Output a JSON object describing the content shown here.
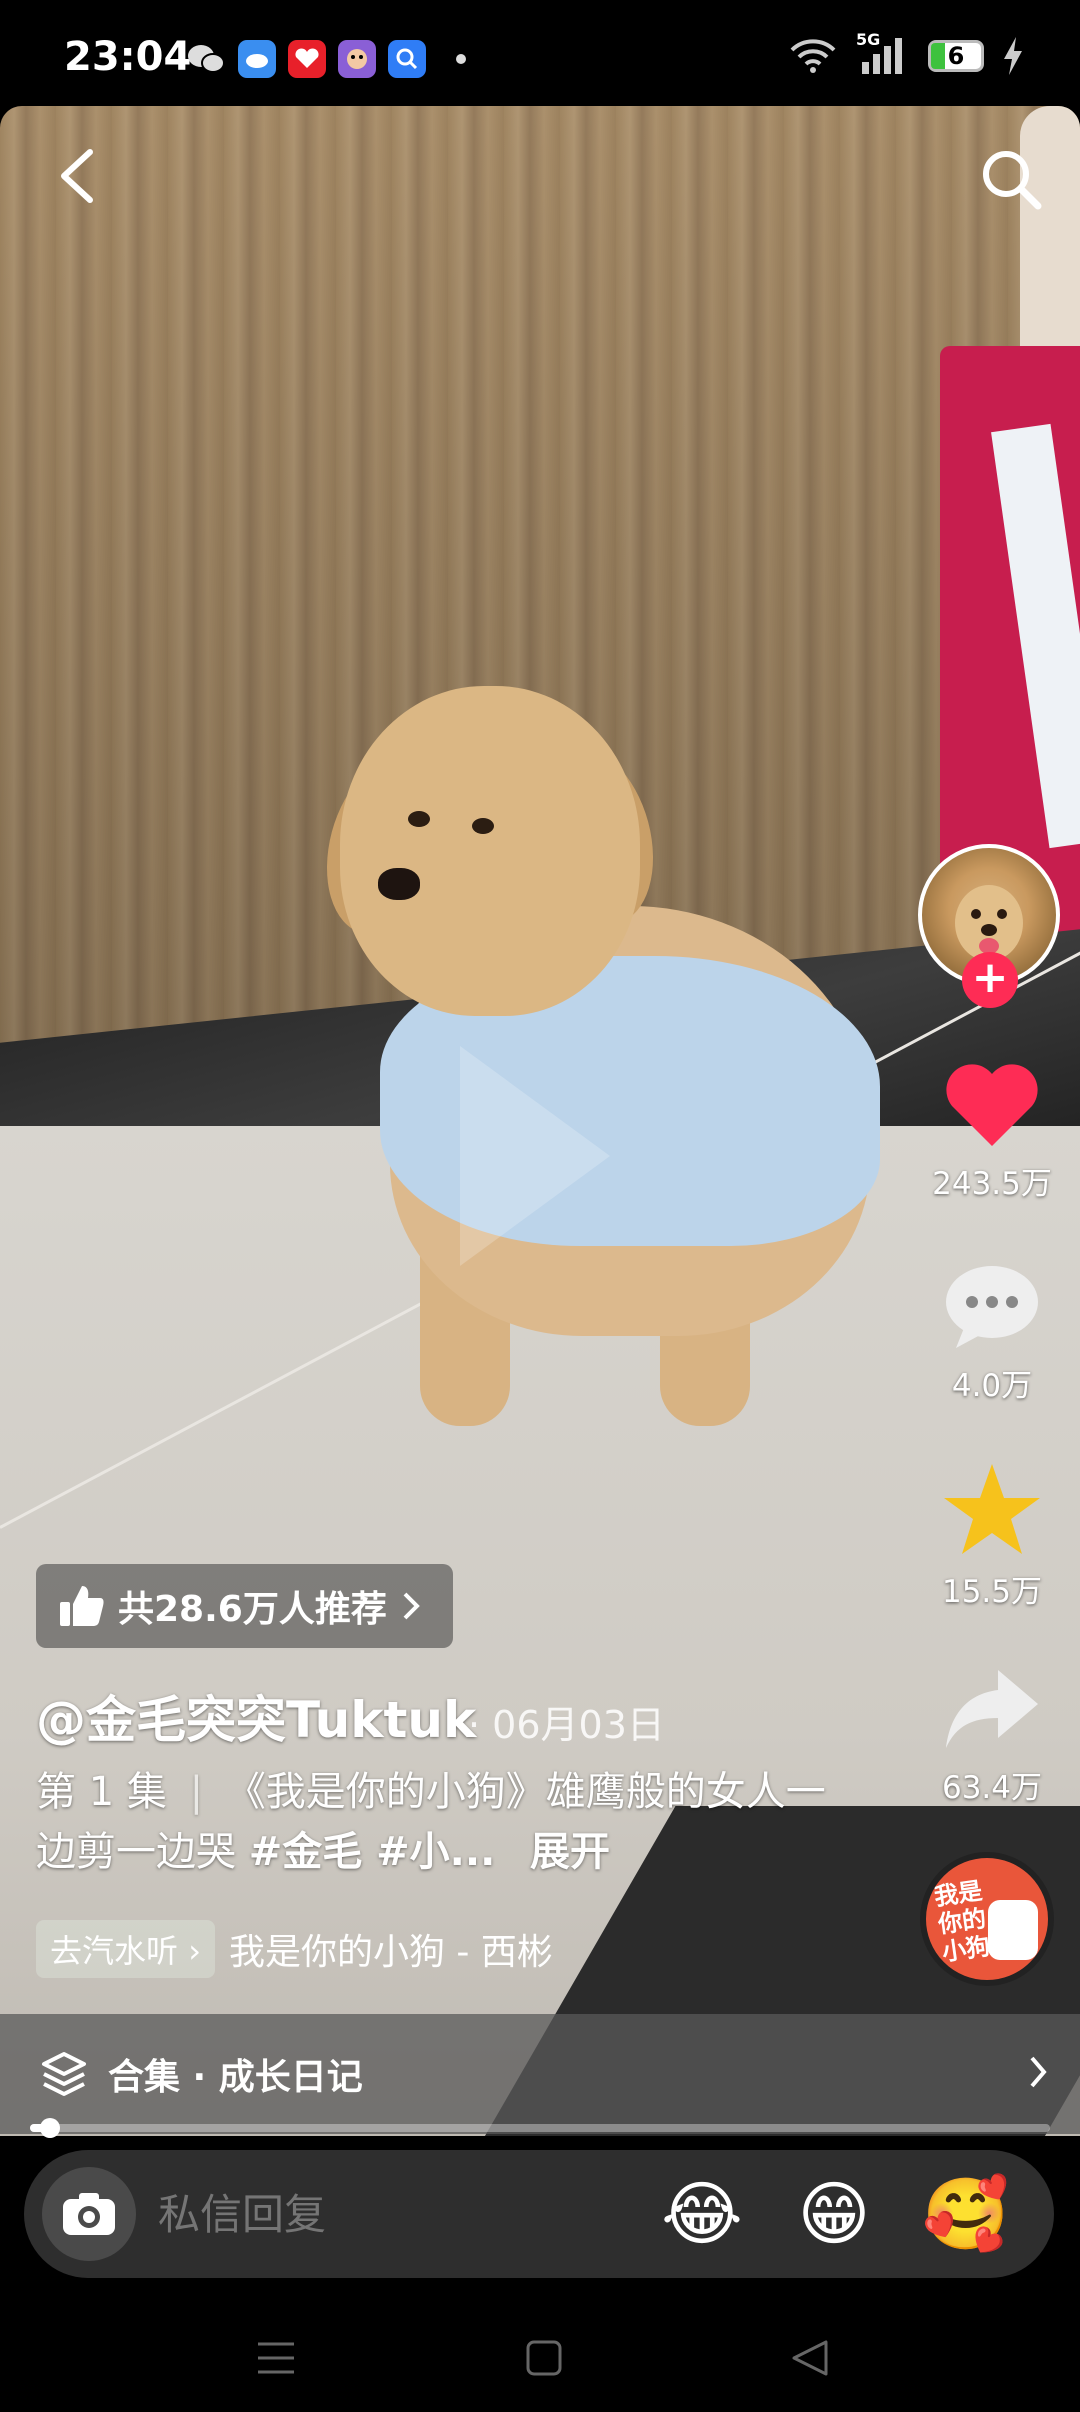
{
  "status_bar": {
    "time": "23:04",
    "network": "5G",
    "battery": "6",
    "app_icons": [
      "wechat-icon",
      "weather-icon",
      "app-red-icon",
      "app-game-icon",
      "search-app-icon"
    ]
  },
  "video": {
    "recommend_label": "共28.6万人推荐",
    "author": "@金毛突突Tuktuk",
    "date": "· 06月03日",
    "episode": "第 1 集",
    "title": "《我是你的小狗》雄鹰般的女人一边剪一边哭",
    "tags": "#金毛 #小...",
    "expand": "展开",
    "music_badge": "去汽水听",
    "music_title": "我是你的小狗 - 西彬",
    "disc_text": "我是你的小狗",
    "progress": 0.02
  },
  "rail": {
    "likes": "243.5万",
    "comments": "4.0万",
    "favorites": "15.5万",
    "shares": "63.4万"
  },
  "collection": {
    "label": "合集 · 成长日记"
  },
  "reply": {
    "placeholder": "私信回复",
    "emojis": [
      "😂",
      "😁",
      "🥰"
    ]
  },
  "colors": {
    "like": "#fe2c55",
    "star": "#f6c21c",
    "plus": "#fe2c55"
  }
}
